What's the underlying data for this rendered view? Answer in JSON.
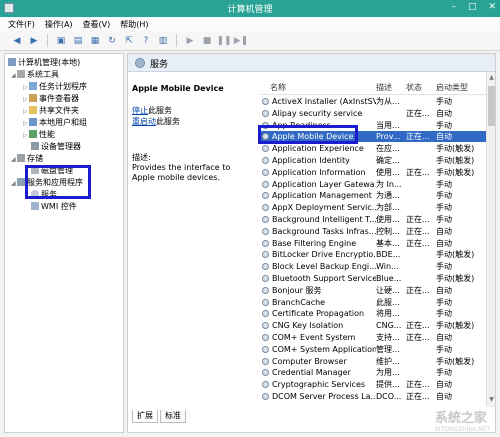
{
  "window": {
    "title": "计算机管理"
  },
  "menu": [
    "文件(F)",
    "操作(A)",
    "查看(V)",
    "帮助(H)"
  ],
  "tree": {
    "root": "计算机管理(本地)",
    "system_tools": "系统工具",
    "task_scheduler": "任务计划程序",
    "event_viewer": "事件查看器",
    "shared_folders": "共享文件夹",
    "local_users": "本地用户和组",
    "performance": "性能",
    "device_manager": "设备管理器",
    "storage": "存储",
    "disk_management": "磁盘管理",
    "services_apps": "服务和应用程序",
    "services": "服务",
    "wmi": "WMI 控件"
  },
  "main": {
    "header": "服务",
    "selected_name": "Apple Mobile Device",
    "stop_link": "停止",
    "stop_suffix": "此服务",
    "restart_link": "重启动",
    "restart_suffix": "此服务",
    "desc_label": "描述:",
    "desc_text": "Provides the interface to Apple mobile devices.",
    "columns": {
      "name": "名称",
      "desc": "描述",
      "status": "状态",
      "startup": "启动类型"
    },
    "services": [
      {
        "name": "ActiveX Installer (AxInstSV)",
        "desc": "为从...",
        "status": "",
        "startup": "手动"
      },
      {
        "name": "Alipay security service",
        "desc": "",
        "status": "正在...",
        "startup": "自动"
      },
      {
        "name": "App Readiness",
        "desc": "当用...",
        "status": "",
        "startup": "手动"
      },
      {
        "name": "Apple Mobile Device",
        "desc": "Prov...",
        "status": "正在...",
        "startup": "自动"
      },
      {
        "name": "Application Experience",
        "desc": "在应...",
        "status": "",
        "startup": "手动(触发)"
      },
      {
        "name": "Application Identity",
        "desc": "确定...",
        "status": "",
        "startup": "手动(触发)"
      },
      {
        "name": "Application Information",
        "desc": "使用...",
        "status": "正在...",
        "startup": "手动(触发)"
      },
      {
        "name": "Application Layer Gatewa...",
        "desc": "为 In...",
        "status": "",
        "startup": "手动"
      },
      {
        "name": "Application Management",
        "desc": "为通...",
        "status": "",
        "startup": "手动"
      },
      {
        "name": "AppX Deployment Servic...",
        "desc": "为部...",
        "status": "",
        "startup": "手动"
      },
      {
        "name": "Background Intelligent T...",
        "desc": "使用...",
        "status": "正在...",
        "startup": "手动"
      },
      {
        "name": "Background Tasks Infras...",
        "desc": "控制...",
        "status": "正在...",
        "startup": "自动"
      },
      {
        "name": "Base Filtering Engine",
        "desc": "基本...",
        "status": "正在...",
        "startup": "自动"
      },
      {
        "name": "BitLocker Drive Encryptio...",
        "desc": "BDE...",
        "status": "",
        "startup": "手动(触发)"
      },
      {
        "name": "Block Level Backup Engi...",
        "desc": "Win...",
        "status": "",
        "startup": "手动"
      },
      {
        "name": "Bluetooth Support Service",
        "desc": "Blue...",
        "status": "",
        "startup": "手动(触发)"
      },
      {
        "name": "Bonjour 服务",
        "desc": "让硬...",
        "status": "正在...",
        "startup": "自动"
      },
      {
        "name": "BranchCache",
        "desc": "此服...",
        "status": "",
        "startup": "手动"
      },
      {
        "name": "Certificate Propagation",
        "desc": "将用...",
        "status": "",
        "startup": "手动"
      },
      {
        "name": "CNG Key Isolation",
        "desc": "CNG...",
        "status": "正在...",
        "startup": "手动(触发)"
      },
      {
        "name": "COM+ Event System",
        "desc": "支持...",
        "status": "正在...",
        "startup": "自动"
      },
      {
        "name": "COM+ System Application",
        "desc": "管理...",
        "status": "",
        "startup": "手动"
      },
      {
        "name": "Computer Browser",
        "desc": "维护...",
        "status": "",
        "startup": "手动(触发)"
      },
      {
        "name": "Credential Manager",
        "desc": "为用...",
        "status": "",
        "startup": "手动"
      },
      {
        "name": "Cryptographic Services",
        "desc": "提供...",
        "status": "正在...",
        "startup": "自动"
      },
      {
        "name": "DCOM Server Process La...",
        "desc": "DCO...",
        "status": "正在...",
        "startup": "自动"
      }
    ]
  },
  "tabs": [
    "扩展",
    "标准"
  ],
  "watermark": {
    "main": "系统之家",
    "sub": "XITONGZHIJIA.NET"
  }
}
